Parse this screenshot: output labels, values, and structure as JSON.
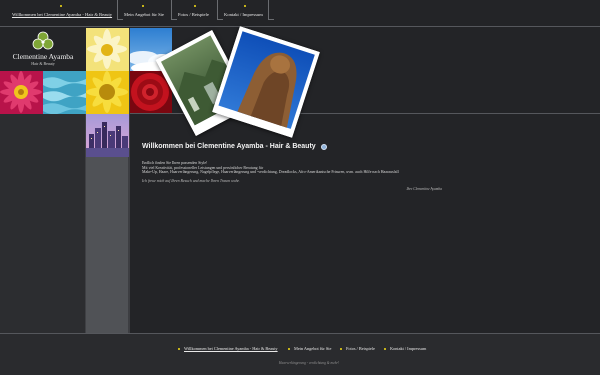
{
  "topnav": {
    "items": [
      {
        "label": "Willkommen bei Clementine Ayamba - Hair & Beauty"
      },
      {
        "label": "Mein Angebot für Sie"
      },
      {
        "label": "Fotos / Beispiele"
      },
      {
        "label": "Kontakt / Impressum"
      }
    ]
  },
  "logo": {
    "name": "Clementine Ayamba",
    "sub": "Hair & Beauty"
  },
  "tiles": [
    {
      "name": "yellow-flower-tile"
    },
    {
      "name": "blue-sky-tile"
    },
    {
      "name": "red-flower-tile"
    },
    {
      "name": "water-tile"
    },
    {
      "name": "sunflower-tile"
    },
    {
      "name": "red-rose-tile"
    },
    {
      "name": "city-night-tile"
    }
  ],
  "main": {
    "title": "Willkommen bei Clementine Ayamba - Hair & Beauty",
    "lines": [
      "Endlich finden Sie Ihren passenden Style!",
      "Mit viel Kreativität, professioneller Leistungen und persönlicher Beratung für",
      "Make-Up, Haare, Haarverlängerung, Nagelpflege, Haarverlängerung und -verdichtung, Dreadlocks, Afro-Amerikanische Frisuren, uvm. auch Hilfe nach Haarausfall"
    ],
    "lead": "Ich freue mich auf Ihren Besuch und mache Ihren Traum wahr.",
    "signature": "Ihre Clementine Ayamba"
  },
  "footer": {
    "items": [
      {
        "label": "Willkommen bei Clementine Ayamba - Hair & Beauty"
      },
      {
        "label": "Mein Angebot für Sie"
      },
      {
        "label": "Fotos / Beispiele"
      },
      {
        "label": "Kontakt / Impressum"
      }
    ],
    "tagline": "Haarverlängerung - verdichtung & mehr!"
  },
  "colors": {
    "background": "#232427",
    "accent_dot": "#c4b21a",
    "logo_green": "#7fa636"
  }
}
